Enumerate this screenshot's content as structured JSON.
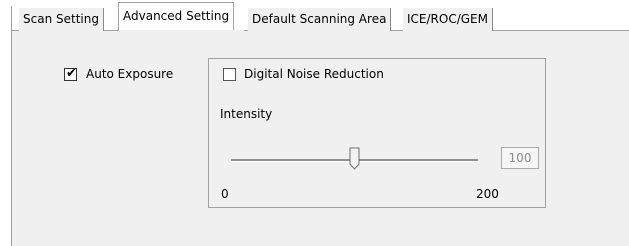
{
  "tabs": [
    {
      "label": "Scan Setting",
      "active": false
    },
    {
      "label": "Advanced Setting",
      "active": true
    },
    {
      "label": "Default Scanning Area",
      "active": false
    },
    {
      "label": "ICE/ROC/GEM",
      "active": false
    }
  ],
  "auto_exposure": {
    "label": "Auto Exposure",
    "checked": true
  },
  "noise_reduction": {
    "checkbox_label": "Digital Noise Reduction",
    "checked": false,
    "intensity_label": "Intensity",
    "slider": {
      "min_label": "0",
      "max_label": "200",
      "value": 100
    },
    "value_box": "100"
  },
  "colors": {
    "panel_bg": "#f0f0f0",
    "border": "#a0a0a0",
    "disabled_text": "#8c8c8c"
  }
}
